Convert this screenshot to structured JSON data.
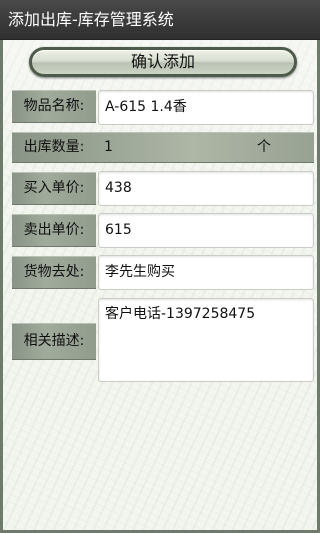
{
  "app": {
    "title": "添加出库-库存管理系统"
  },
  "form": {
    "confirm_label": "确认添加",
    "item_name": {
      "label": "物品名称:",
      "value": "A-615 1.4香"
    },
    "quantity": {
      "label": "出库数量:",
      "value": "1",
      "unit": "个"
    },
    "buy_price": {
      "label": "买入单价:",
      "value": "438"
    },
    "sell_price": {
      "label": "卖出单价:",
      "value": "615"
    },
    "destination": {
      "label": "货物去处:",
      "value": "李先生购买"
    },
    "description": {
      "label": "相关描述:",
      "value": "客户电话-1397258475"
    }
  },
  "colors": {
    "titlebar": "#3c3c3c",
    "label_bg": "#9aa396",
    "frame": "#6e7a6c",
    "content_bg": "#f3f5ef"
  }
}
